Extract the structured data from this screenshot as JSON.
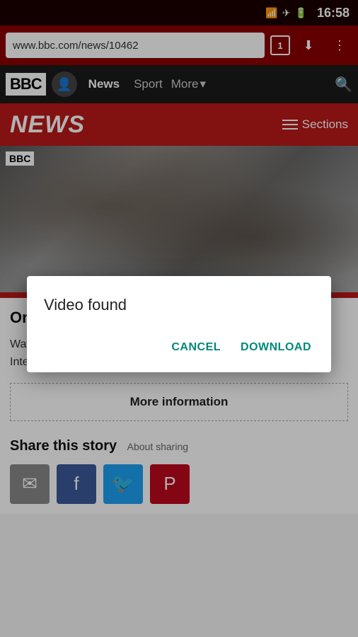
{
  "statusBar": {
    "time": "16:58",
    "icons": [
      "wifi",
      "airplane",
      "battery"
    ]
  },
  "browserBar": {
    "url": "www.bbc.com/news/10462",
    "tabNumber": "1"
  },
  "navBar": {
    "logoText": "BBC",
    "links": [
      {
        "label": "News",
        "active": true
      },
      {
        "label": "Sport",
        "active": false
      },
      {
        "label": "More",
        "active": false
      }
    ]
  },
  "newsHeader": {
    "title": "NEWS",
    "sectionsLabel": "Sections"
  },
  "dialog": {
    "title": "Video found",
    "cancelLabel": "CANCEL",
    "downloadLabel": "DOWNLOAD"
  },
  "article": {
    "title": "One-minute World News",
    "description": "Watch the latest news summary from BBC World News. International news updated 24 hours a day.",
    "moreInfoLabel": "More information"
  },
  "share": {
    "title": "Share this story",
    "aboutLabel": "About sharing"
  }
}
